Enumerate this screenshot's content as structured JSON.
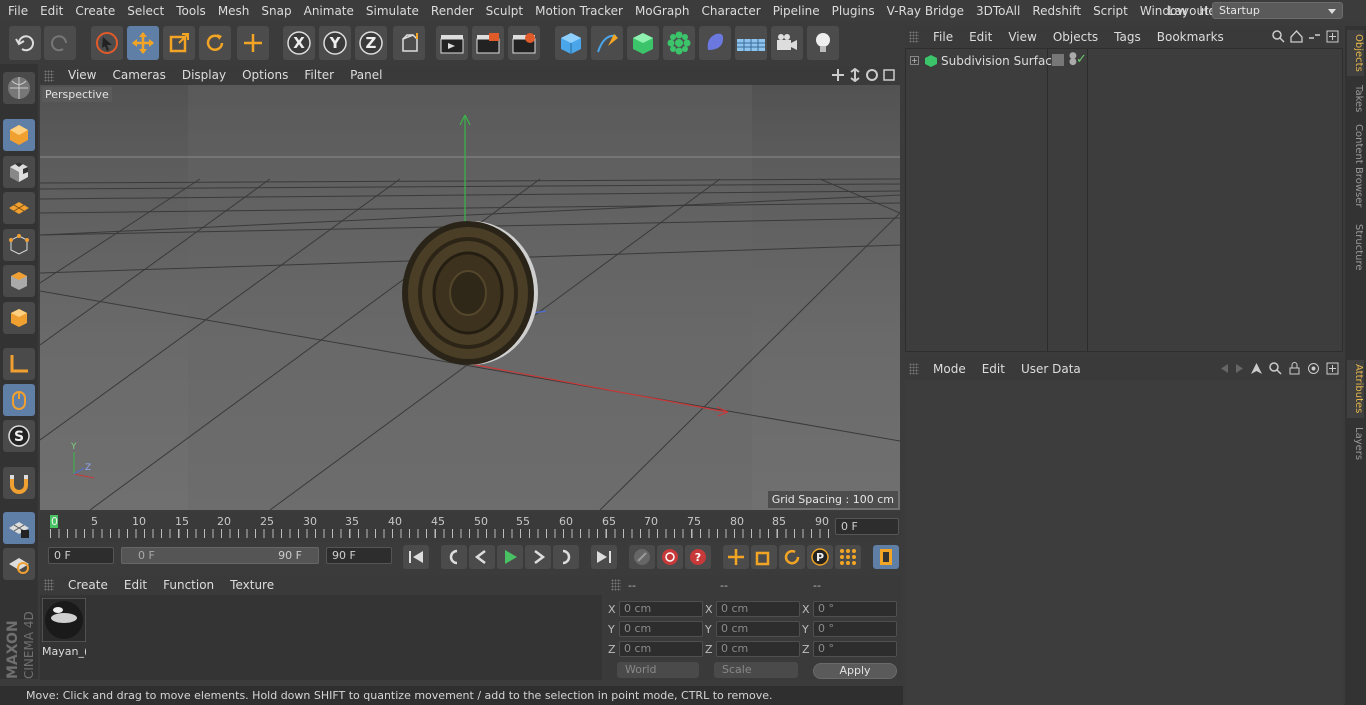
{
  "menu": [
    "File",
    "Edit",
    "Create",
    "Select",
    "Tools",
    "Mesh",
    "Snap",
    "Animate",
    "Simulate",
    "Render",
    "Sculpt",
    "Motion Tracker",
    "MoGraph",
    "Character",
    "Pipeline",
    "Plugins",
    "V-Ray Bridge",
    "3DToAll",
    "Redshift",
    "Script",
    "Window",
    "Help"
  ],
  "layout": {
    "label": "Layout:",
    "value": "Startup"
  },
  "viewport": {
    "menu": [
      "View",
      "Cameras",
      "Display",
      "Options",
      "Filter",
      "Panel"
    ],
    "camera_label": "Perspective",
    "grid_spacing": "Grid Spacing : 100 cm",
    "axis_labels": {
      "y": "Y",
      "z": "Z"
    }
  },
  "timeline": {
    "ticks": [
      "0",
      "5",
      "10",
      "15",
      "20",
      "25",
      "30",
      "35",
      "40",
      "45",
      "50",
      "55",
      "60",
      "65",
      "70",
      "75",
      "80",
      "85",
      "90"
    ],
    "current_frame": "0 F",
    "start_field": "0 F",
    "range_start": "0 F",
    "range_end": "90 F",
    "end_field": "90 F"
  },
  "material_manager": {
    "menu": [
      "Create",
      "Edit",
      "Function",
      "Texture"
    ],
    "materials": [
      {
        "name": "Mayan_("
      }
    ]
  },
  "coordinates": {
    "headers": [
      "--",
      "--",
      "--"
    ],
    "rows": [
      {
        "axis": "X",
        "pos": "0 cm",
        "size_axis": "X",
        "size": "0 cm",
        "rot_axis": "X",
        "rot": "0 °"
      },
      {
        "axis": "Y",
        "pos": "0 cm",
        "size_axis": "Y",
        "size": "0 cm",
        "rot_axis": "Y",
        "rot": "0 °"
      },
      {
        "axis": "Z",
        "pos": "0 cm",
        "size_axis": "Z",
        "size": "0 cm",
        "rot_axis": "Z",
        "rot": "0 °"
      }
    ],
    "mode_world": "World",
    "mode_scale": "Scale",
    "apply": "Apply"
  },
  "status_text": "Move: Click and drag to move elements. Hold down SHIFT to quantize movement / add to the selection in point mode, CTRL to remove.",
  "object_manager": {
    "menu": [
      "File",
      "Edit",
      "View",
      "Objects",
      "Tags",
      "Bookmarks"
    ],
    "objects": [
      {
        "name": "Subdivision Surface"
      }
    ]
  },
  "attribute_manager": {
    "menu": [
      "Mode",
      "Edit",
      "User Data"
    ]
  },
  "right_tabs": [
    "Objects",
    "Takes",
    "Content Browser",
    "Structure",
    "Attributes",
    "Layers"
  ],
  "logo": {
    "line1": "MAXON",
    "line2": "CINEMA 4D"
  },
  "colors": {
    "accent": "#5f7fa6",
    "tab_active": "#e5b64b",
    "x_axis": "#c83a3a",
    "y_axis": "#3ab54a",
    "z_axis": "#4b6fd8"
  }
}
